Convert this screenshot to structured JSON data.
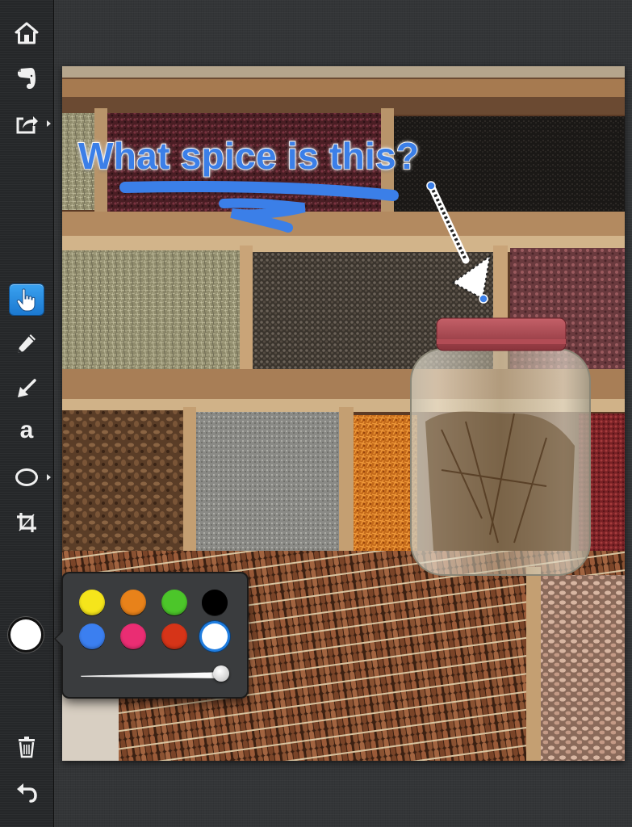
{
  "toolbar": {
    "tools": [
      {
        "name": "home-icon"
      },
      {
        "name": "evernote-icon"
      },
      {
        "name": "share-icon"
      },
      {
        "name": "hand-pointer-icon",
        "active": true
      },
      {
        "name": "pencil-icon"
      },
      {
        "name": "arrow-icon"
      },
      {
        "name": "text-tool-icon",
        "glyph": "a"
      },
      {
        "name": "ellipse-icon"
      },
      {
        "name": "crop-icon"
      }
    ],
    "current_color": "#ffffff",
    "trash": "trash-icon",
    "undo": "undo-icon"
  },
  "annotation": {
    "text": "What spice is this?",
    "text_color": "#3b7fe8",
    "stroke_color": "#3b7fe8"
  },
  "color_picker": {
    "swatches": [
      {
        "color": "#f5e51b",
        "name": "yellow"
      },
      {
        "color": "#e8821a",
        "name": "orange"
      },
      {
        "color": "#4cc62a",
        "name": "green"
      },
      {
        "color": "#000000",
        "name": "black"
      },
      {
        "color": "#3b7ff0",
        "name": "blue"
      },
      {
        "color": "#ea2d73",
        "name": "pink"
      },
      {
        "color": "#d63418",
        "name": "red"
      },
      {
        "color": "#ffffff",
        "name": "white",
        "selected": true
      }
    ],
    "stroke_width": 0.92
  }
}
